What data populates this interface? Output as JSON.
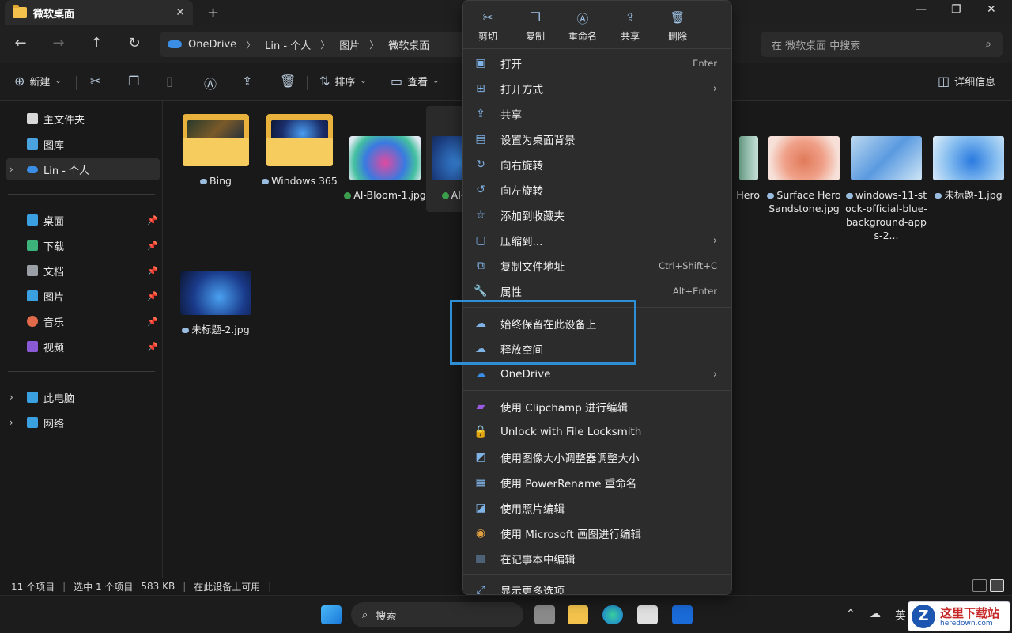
{
  "window": {
    "tab_title": "微软桌面",
    "close_tab": "✕",
    "new_tab": "+"
  },
  "address": {
    "crumbs": [
      "OneDrive",
      "Lin - 个人",
      "图片",
      "微软桌面"
    ],
    "search_placeholder": "在 微软桌面 中搜索"
  },
  "toolbar": {
    "new_label": "新建",
    "sort_label": "排序",
    "view_label": "查看",
    "details_label": "详细信息"
  },
  "sidebar": {
    "items": [
      {
        "label": "主文件夹",
        "icon": "home-icon",
        "color": "#e0e0e0"
      },
      {
        "label": "图库",
        "icon": "gallery-icon",
        "color": "#4aa3df"
      },
      {
        "label": "Lin - 个人",
        "icon": "onedrive-icon",
        "color": "#3a8ee6"
      },
      {
        "label": "桌面",
        "icon": "desktop-icon",
        "color": "#3aa0e0"
      },
      {
        "label": "下载",
        "icon": "download-icon",
        "color": "#3bb37a"
      },
      {
        "label": "文档",
        "icon": "document-icon",
        "color": "#9aa0a6"
      },
      {
        "label": "图片",
        "icon": "pictures-icon",
        "color": "#3aa0e0"
      },
      {
        "label": "音乐",
        "icon": "music-icon",
        "color": "#e06a4a"
      },
      {
        "label": "视频",
        "icon": "video-icon",
        "color": "#8a5ad6"
      },
      {
        "label": "此电脑",
        "icon": "pc-icon",
        "color": "#3aa0e0"
      },
      {
        "label": "网络",
        "icon": "network-icon",
        "color": "#3aa0e0"
      }
    ]
  },
  "files": [
    {
      "name": "Bing",
      "type": "folder",
      "status": "cloud"
    },
    {
      "name": "Windows 365",
      "type": "folder",
      "status": "cloud"
    },
    {
      "name": "AI-Bloom-1.jpg",
      "type": "image",
      "status": "synced"
    },
    {
      "name": "AI-B...pg",
      "type": "image",
      "status": "synced"
    },
    {
      "name": "Hero",
      "type": "image",
      "status": ""
    },
    {
      "name": "Surface Hero Sandstone.jpg",
      "type": "image",
      "status": "cloud"
    },
    {
      "name": "windows-11-stock-official-blue-background-apps-2...",
      "type": "image",
      "status": "cloud"
    },
    {
      "name": "未标题-1.jpg",
      "type": "image",
      "status": "cloud"
    },
    {
      "name": "未标题-2.jpg",
      "type": "image",
      "status": "cloud"
    }
  ],
  "status": {
    "count": "11 个项目",
    "selected": "选中 1 个项目",
    "size": "583 KB",
    "availability": "在此设备上可用"
  },
  "context_menu": {
    "quick_actions": [
      "剪切",
      "复制",
      "重命名",
      "共享",
      "删除"
    ],
    "items": [
      {
        "label": "打开",
        "shortcut": "Enter",
        "icon": "open-icon"
      },
      {
        "label": "打开方式",
        "submenu": true,
        "icon": "open-with-icon"
      },
      {
        "label": "共享",
        "icon": "share-icon"
      },
      {
        "label": "设置为桌面背景",
        "icon": "wallpaper-icon"
      },
      {
        "label": "向右旋转",
        "icon": "rotate-right-icon"
      },
      {
        "label": "向左旋转",
        "icon": "rotate-left-icon"
      },
      {
        "label": "添加到收藏夹",
        "icon": "star-icon"
      },
      {
        "label": "压缩到...",
        "submenu": true,
        "icon": "zip-icon"
      },
      {
        "label": "复制文件地址",
        "shortcut": "Ctrl+Shift+C",
        "icon": "copy-path-icon"
      },
      {
        "label": "属性",
        "shortcut": "Alt+Enter",
        "icon": "wrench-icon"
      },
      {
        "label": "始终保留在此设备上",
        "icon": "cloud-keep-icon"
      },
      {
        "label": "释放空间",
        "icon": "cloud-free-icon"
      },
      {
        "label": "OneDrive",
        "submenu": true,
        "icon": "onedrive-icon"
      },
      {
        "label": "使用 Clipchamp 进行编辑",
        "icon": "clipchamp-icon"
      },
      {
        "label": "Unlock with File Locksmith",
        "icon": "lock-icon"
      },
      {
        "label": "使用图像大小调整器调整大小",
        "icon": "resize-icon"
      },
      {
        "label": "使用 PowerRename 重命名",
        "icon": "powerrename-icon"
      },
      {
        "label": "使用照片编辑",
        "icon": "photos-icon"
      },
      {
        "label": "使用 Microsoft 画图进行编辑",
        "icon": "paint-icon"
      },
      {
        "label": "在记事本中编辑",
        "icon": "notepad-icon"
      },
      {
        "label": "显示更多选项",
        "icon": "more-options-icon"
      }
    ]
  },
  "taskbar": {
    "search_label": "搜索",
    "ime": "英"
  },
  "watermark": {
    "title": "这里下载站",
    "subtitle": "heredown.com"
  },
  "colors": {
    "accent": "#2f8fd6",
    "background": "#191919",
    "menu": "#2c2c2c"
  }
}
